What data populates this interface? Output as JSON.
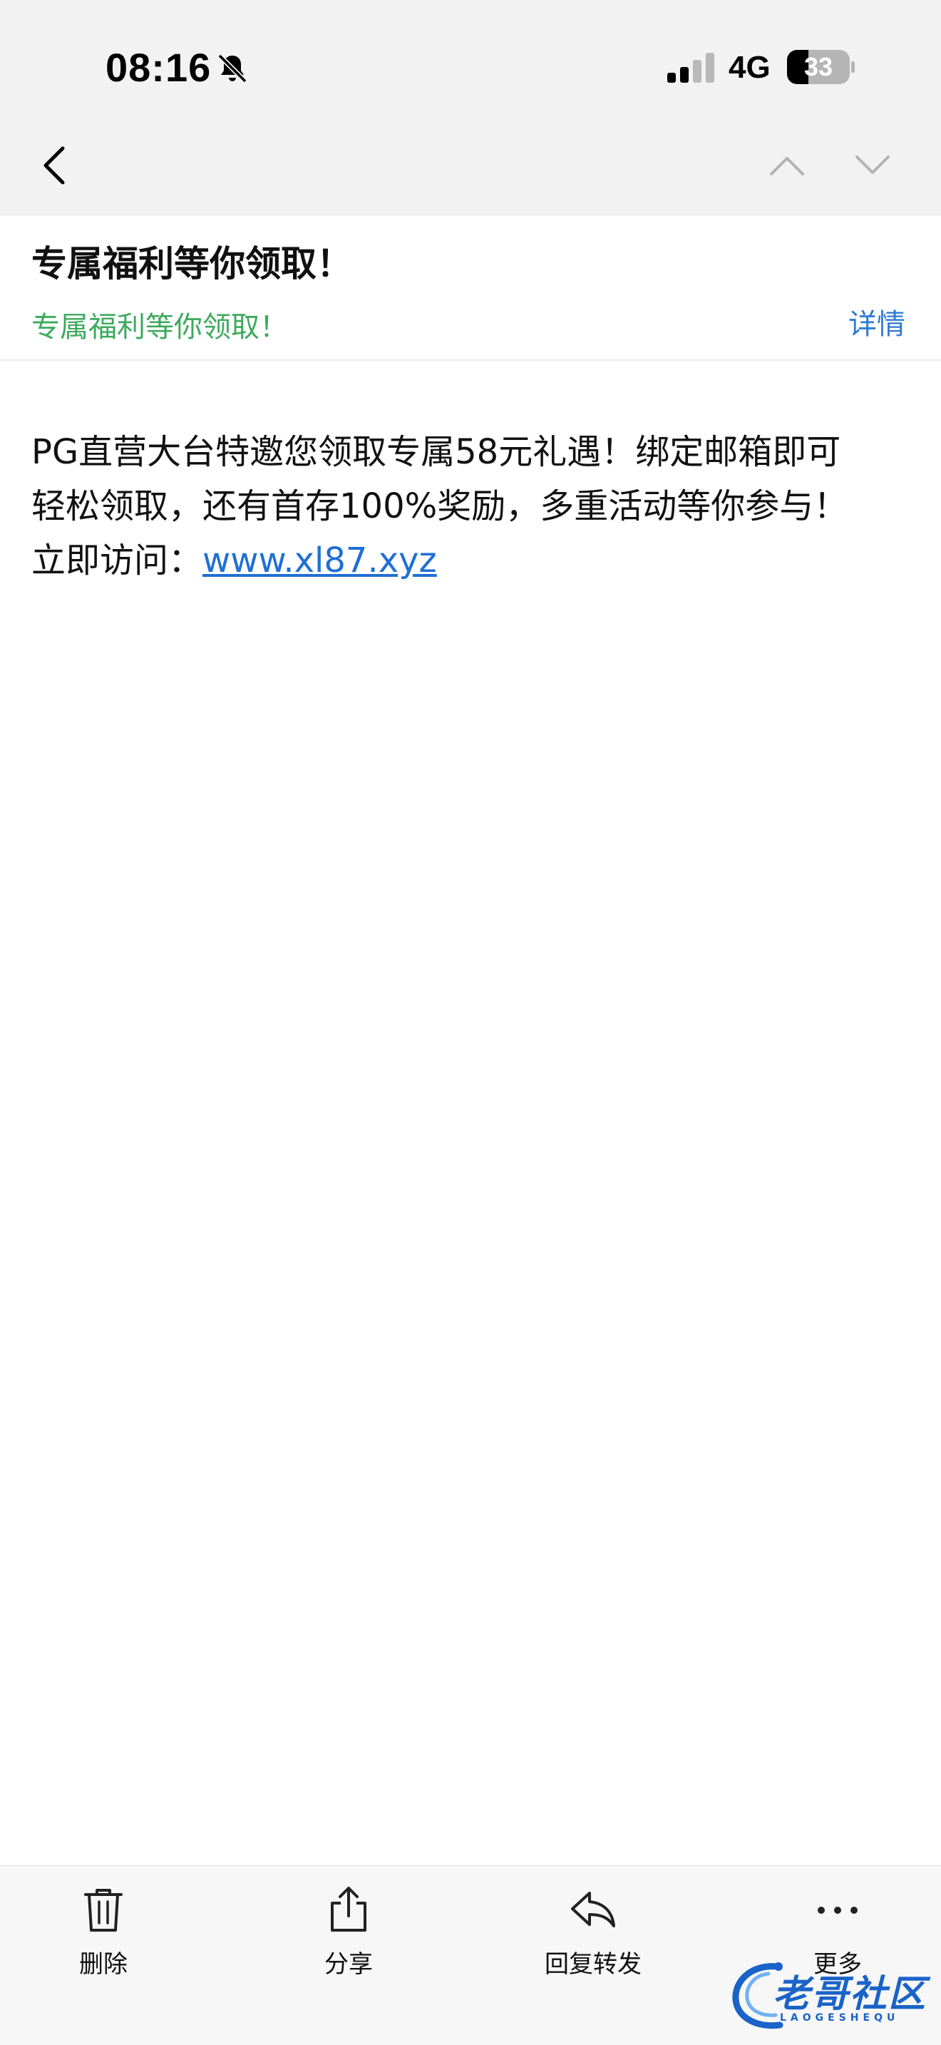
{
  "status_bar": {
    "time": "08:16",
    "network": "4G",
    "battery": "33",
    "icons": [
      "bell-off-icon",
      "signal-icon",
      "battery-icon"
    ]
  },
  "nav": {
    "icons": [
      "chevron-left-icon",
      "chevron-up-icon",
      "chevron-down-icon"
    ]
  },
  "header": {
    "subject": "专属福利等你领取！",
    "sender": "专属福利等你领取！",
    "details_label": "详情"
  },
  "body": {
    "line1": "PG直营大台特邀您领取专属58元礼遇！绑定邮箱即可",
    "line2": "轻松领取，还有首存100%奖励，多重活动等你参与！",
    "line3_prefix": "立即访问：",
    "link": "www.xl87.xyz"
  },
  "toolbar": {
    "delete_label": "删除",
    "share_label": "分享",
    "reply_label": "回复转发",
    "more_label": "更多"
  },
  "watermark": {
    "text": "老哥社区",
    "sub": "LAOGESHEQU"
  },
  "colors": {
    "sender": "#3daa5c",
    "details": "#2f7bd3",
    "link": "#1f6fd6",
    "watermark": "#1a63c8"
  }
}
